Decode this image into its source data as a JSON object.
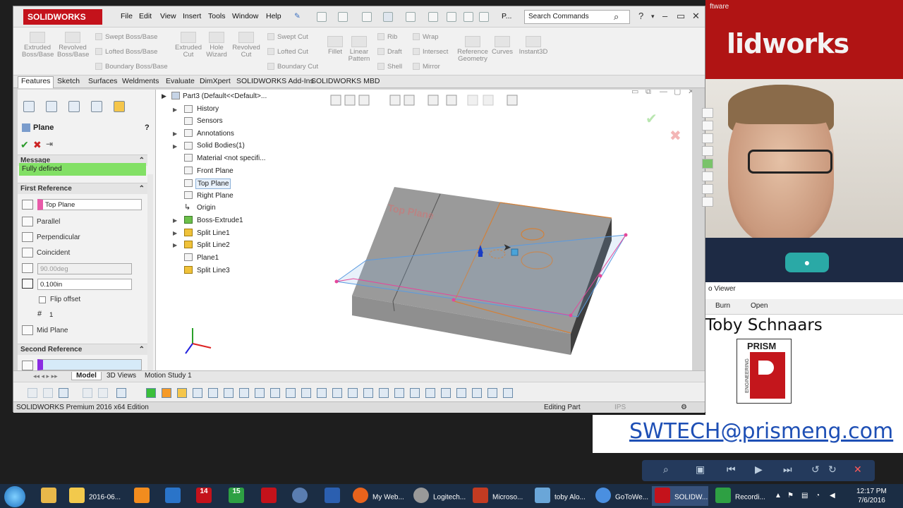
{
  "background": {
    "top_right_title": "ftware",
    "top_right_brand": "lidworks",
    "viewer_title": "o Viewer",
    "viewer_buttons": [
      "Burn",
      "Open"
    ],
    "presenter_name": "Toby Schnaars",
    "prism_logo_text": "PRISM",
    "prism_logo_subtext": "ENGINEERING",
    "email": "SWTECH@prismeng.com"
  },
  "sw": {
    "logo": "SOLIDWORKS",
    "menu": [
      "File",
      "Edit",
      "View",
      "Insert",
      "Tools",
      "Window",
      "Help"
    ],
    "extra_menu": "P...",
    "search_placeholder": "Search Commands",
    "ribbon": {
      "extruded_boss": "Extruded Boss/Base",
      "revolved_boss": "Revolved Boss/Base",
      "swept_boss": "Swept Boss/Base",
      "lofted_boss": "Lofted Boss/Base",
      "boundary_boss": "Boundary Boss/Base",
      "extruded_cut": "Extruded Cut",
      "hole_wizard": "Hole Wizard",
      "revolved_cut": "Revolved Cut",
      "swept_cut": "Swept Cut",
      "lofted_cut": "Lofted Cut",
      "boundary_cut": "Boundary Cut",
      "fillet": "Fillet",
      "linear_pattern": "Linear Pattern",
      "rib": "Rib",
      "draft": "Draft",
      "shell": "Shell",
      "wrap": "Wrap",
      "intersect": "Intersect",
      "mirror": "Mirror",
      "reference_geometry": "Reference Geometry",
      "curves": "Curves",
      "instant3d": "Instant3D"
    },
    "tabs": [
      "Features",
      "Sketch",
      "Surfaces",
      "Weldments",
      "Evaluate",
      "DimXpert",
      "SOLIDWORKS Add-Ins",
      "SOLIDWORKS MBD"
    ],
    "property_manager": {
      "title": "Plane",
      "help": "?",
      "message_header": "Message",
      "message": "Fully defined",
      "first_reference_header": "First Reference",
      "first_reference_value": "Top Plane",
      "options": [
        "Parallel",
        "Perpendicular",
        "Coincident"
      ],
      "angle_value": "90.00deg",
      "offset_value": "0.100in",
      "flip_offset": "Flip offset",
      "instances_value": "1",
      "mid_plane": "Mid Plane",
      "second_reference_header": "Second Reference"
    },
    "feature_tree": {
      "root": "Part3  (Default<<Default>...",
      "items": [
        "History",
        "Sensors",
        "Annotations",
        "Solid Bodies(1)",
        "Material <not specifi...",
        "Front Plane",
        "Top Plane",
        "Right Plane",
        "Origin",
        "Boss-Extrude1",
        "Split Line1",
        "Split Line2",
        "Plane1",
        "Split Line3"
      ]
    },
    "model_label": "Top Plane",
    "bottom_tabs": [
      "Model",
      "3D Views",
      "Motion Study 1"
    ],
    "status": {
      "edition": "SOLIDWORKS Premium 2016 x64 Edition",
      "mode": "Editing Part",
      "units": "IPS"
    }
  },
  "taskbar": {
    "items": [
      "2016-06...",
      "My Web...",
      "Logitech...",
      "Microso...",
      "toby Alo...",
      "GoToWe...",
      "SOLIDW...",
      "Recordi..."
    ],
    "badges": [
      "14",
      "15"
    ],
    "time": "12:17 PM",
    "date": "7/6/2016"
  },
  "colors": {
    "sw_red": "#c4121b",
    "accent_blue": "#1e4fb5",
    "fully_defined_green": "#82e065",
    "plane_magenta": "#e5479a",
    "taskbar": "#1b2d44"
  }
}
